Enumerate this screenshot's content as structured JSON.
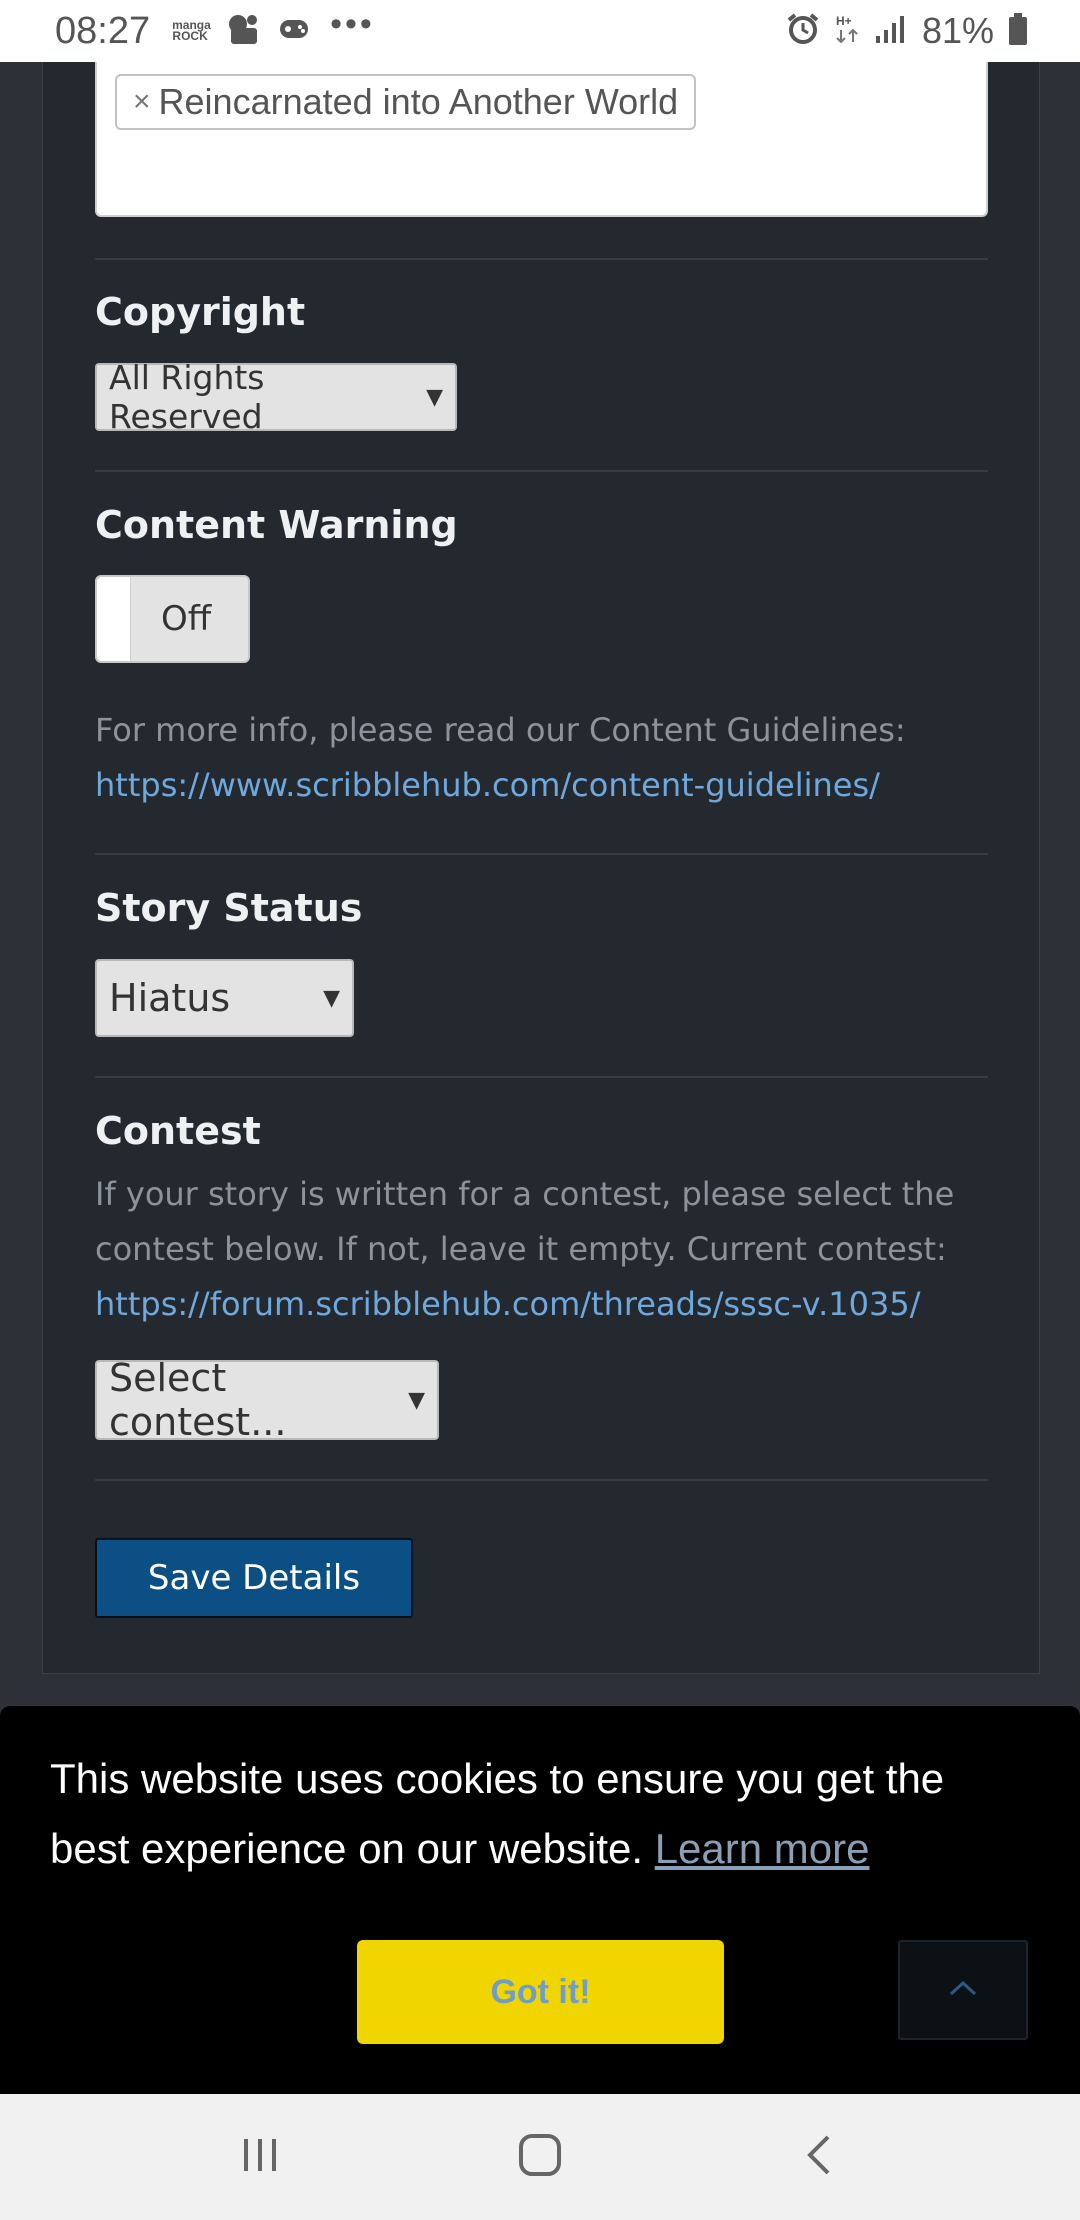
{
  "status_bar": {
    "time": "08:27",
    "notification_icons": [
      "manga-rock-icon",
      "notification-icon",
      "game-controller-icon",
      "more-dots-icon"
    ],
    "manga_rock_label": "manga ROCK",
    "more": "•••",
    "battery_percent": "81%"
  },
  "tags": {
    "items": [
      {
        "remove": "×",
        "label": "Reincarnated into Another World"
      }
    ]
  },
  "copyright": {
    "label": "Copyright",
    "selected": "All Rights Reserved"
  },
  "content_warning": {
    "label": "Content Warning",
    "toggle_state": "Off",
    "info_text": "For more info, please read our Content Guidelines:",
    "info_link": "https://www.scribblehub.com/content-guidelines/"
  },
  "story_status": {
    "label": "Story Status",
    "selected": "Hiatus"
  },
  "contest": {
    "label": "Contest",
    "description_line1": "If your story is written for a contest, please select the",
    "description_line2": "contest below. If not, leave it empty. Current contest:",
    "link": "https://forum.scribblehub.com/threads/sssc-v.1035/",
    "selected": "Select contest..."
  },
  "save_button": "Save Details",
  "cookie_banner": {
    "message_line1": "This website uses cookies to ensure you get the",
    "message_line2": "best experience on our website.",
    "learn_more": "Learn more",
    "accept": "Got it!"
  },
  "nav_bar": {
    "buttons": [
      "recent-apps-icon",
      "home-icon",
      "back-icon"
    ]
  },
  "colors": {
    "page_bg": "#242930",
    "accent_link": "#6ea8dc",
    "save_button_bg": "#0b4f84",
    "cookie_button_bg": "#f0d500"
  }
}
